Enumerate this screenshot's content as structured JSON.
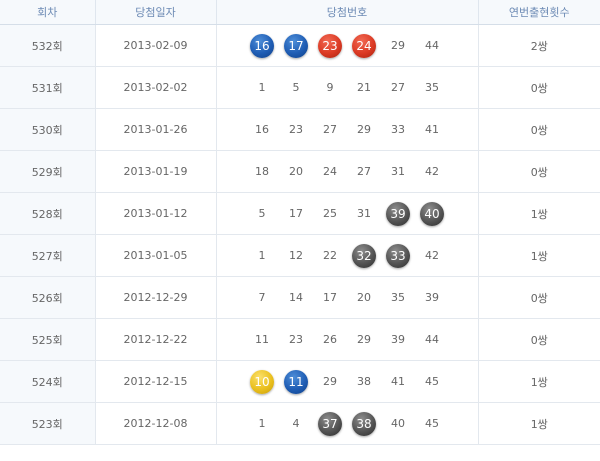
{
  "headers": [
    "회차",
    "당첨일자",
    "당첨번호",
    "연번출현횟수"
  ],
  "rows": [
    {
      "round": "532회",
      "date": "2013-02-09",
      "count": "2쌍",
      "numbers": [
        {
          "v": "16",
          "c": "blue"
        },
        {
          "v": "17",
          "c": "blue"
        },
        {
          "v": "23",
          "c": "red"
        },
        {
          "v": "24",
          "c": "red"
        },
        {
          "v": "29",
          "c": ""
        },
        {
          "v": "44",
          "c": ""
        }
      ]
    },
    {
      "round": "531회",
      "date": "2013-02-02",
      "count": "0쌍",
      "numbers": [
        {
          "v": "1",
          "c": ""
        },
        {
          "v": "5",
          "c": ""
        },
        {
          "v": "9",
          "c": ""
        },
        {
          "v": "21",
          "c": ""
        },
        {
          "v": "27",
          "c": ""
        },
        {
          "v": "35",
          "c": ""
        }
      ]
    },
    {
      "round": "530회",
      "date": "2013-01-26",
      "count": "0쌍",
      "numbers": [
        {
          "v": "16",
          "c": ""
        },
        {
          "v": "23",
          "c": ""
        },
        {
          "v": "27",
          "c": ""
        },
        {
          "v": "29",
          "c": ""
        },
        {
          "v": "33",
          "c": ""
        },
        {
          "v": "41",
          "c": ""
        }
      ]
    },
    {
      "round": "529회",
      "date": "2013-01-19",
      "count": "0쌍",
      "numbers": [
        {
          "v": "18",
          "c": ""
        },
        {
          "v": "20",
          "c": ""
        },
        {
          "v": "24",
          "c": ""
        },
        {
          "v": "27",
          "c": ""
        },
        {
          "v": "31",
          "c": ""
        },
        {
          "v": "42",
          "c": ""
        }
      ]
    },
    {
      "round": "528회",
      "date": "2013-01-12",
      "count": "1쌍",
      "numbers": [
        {
          "v": "5",
          "c": ""
        },
        {
          "v": "17",
          "c": ""
        },
        {
          "v": "25",
          "c": ""
        },
        {
          "v": "31",
          "c": ""
        },
        {
          "v": "39",
          "c": "gray"
        },
        {
          "v": "40",
          "c": "gray"
        }
      ]
    },
    {
      "round": "527회",
      "date": "2013-01-05",
      "count": "1쌍",
      "numbers": [
        {
          "v": "1",
          "c": ""
        },
        {
          "v": "12",
          "c": ""
        },
        {
          "v": "22",
          "c": ""
        },
        {
          "v": "32",
          "c": "gray"
        },
        {
          "v": "33",
          "c": "gray"
        },
        {
          "v": "42",
          "c": ""
        }
      ]
    },
    {
      "round": "526회",
      "date": "2012-12-29",
      "count": "0쌍",
      "numbers": [
        {
          "v": "7",
          "c": ""
        },
        {
          "v": "14",
          "c": ""
        },
        {
          "v": "17",
          "c": ""
        },
        {
          "v": "20",
          "c": ""
        },
        {
          "v": "35",
          "c": ""
        },
        {
          "v": "39",
          "c": ""
        }
      ]
    },
    {
      "round": "525회",
      "date": "2012-12-22",
      "count": "0쌍",
      "numbers": [
        {
          "v": "11",
          "c": ""
        },
        {
          "v": "23",
          "c": ""
        },
        {
          "v": "26",
          "c": ""
        },
        {
          "v": "29",
          "c": ""
        },
        {
          "v": "39",
          "c": ""
        },
        {
          "v": "44",
          "c": ""
        }
      ]
    },
    {
      "round": "524회",
      "date": "2012-12-15",
      "count": "1쌍",
      "numbers": [
        {
          "v": "10",
          "c": "yellow"
        },
        {
          "v": "11",
          "c": "blue"
        },
        {
          "v": "29",
          "c": ""
        },
        {
          "v": "38",
          "c": ""
        },
        {
          "v": "41",
          "c": ""
        },
        {
          "v": "45",
          "c": ""
        }
      ]
    },
    {
      "round": "523회",
      "date": "2012-12-08",
      "count": "1쌍",
      "numbers": [
        {
          "v": "1",
          "c": ""
        },
        {
          "v": "4",
          "c": ""
        },
        {
          "v": "37",
          "c": "gray"
        },
        {
          "v": "38",
          "c": "gray"
        },
        {
          "v": "40",
          "c": ""
        },
        {
          "v": "45",
          "c": ""
        }
      ]
    }
  ]
}
